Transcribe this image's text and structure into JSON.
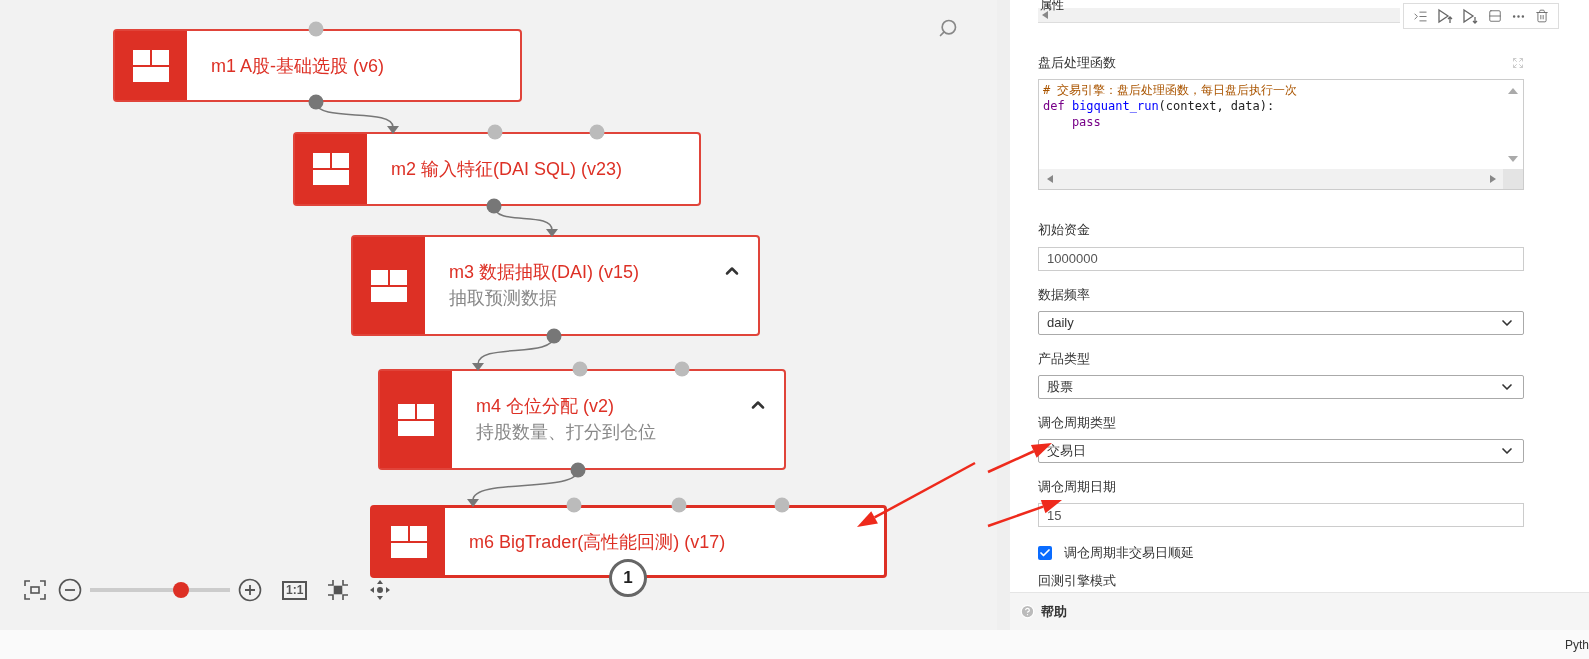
{
  "canvas": {
    "nodes": [
      {
        "title": "m1 A股-基础选股 (v6)",
        "selected": false
      },
      {
        "title": "m2 输入特征(DAI SQL) (v23)",
        "selected": false
      },
      {
        "title": "m3 数据抽取(DAI) (v15)",
        "subtitle": "抽取预测数据",
        "expanded": true,
        "selected": false
      },
      {
        "title": "m4 仓位分配 (v2)",
        "subtitle": "持股数量、打分到仓位",
        "expanded": true,
        "selected": false
      },
      {
        "title": "m6 BigTrader(高性能回测) (v17)",
        "selected": true,
        "badge": "1"
      }
    ],
    "zoom": {
      "level": 0.65,
      "actual_size": "1:1"
    }
  },
  "panel": {
    "section_title": "属性",
    "editor": {
      "label": "盘后处理函数",
      "lines": [
        [
          {
            "kind": "comment",
            "text": "# 交易引擎：盘后处理函数，每日盘后执行一次"
          }
        ],
        [
          {
            "kind": "keyword",
            "text": "def "
          },
          {
            "kind": "function",
            "text": "bigquant_run"
          },
          {
            "kind": "plain",
            "text": "(context, data):"
          }
        ],
        [
          {
            "kind": "keyword",
            "text": "    pass"
          }
        ]
      ]
    },
    "fields": [
      {
        "kind": "text",
        "label": "初始资金",
        "value": "1000000"
      },
      {
        "kind": "select",
        "label": "数据频率",
        "value": "daily"
      },
      {
        "kind": "select",
        "label": "产品类型",
        "value": "股票"
      },
      {
        "kind": "select",
        "label": "调仓周期类型",
        "value": "交易日"
      },
      {
        "kind": "text",
        "label": "调仓周期日期",
        "value": "15"
      },
      {
        "kind": "checkbox",
        "label": "调仓周期非交易日顺延",
        "checked": true
      },
      {
        "kind": "heading",
        "label": "回测引擎模式"
      }
    ],
    "help": "帮助"
  },
  "status_bar": {
    "language": "Pyth"
  }
}
